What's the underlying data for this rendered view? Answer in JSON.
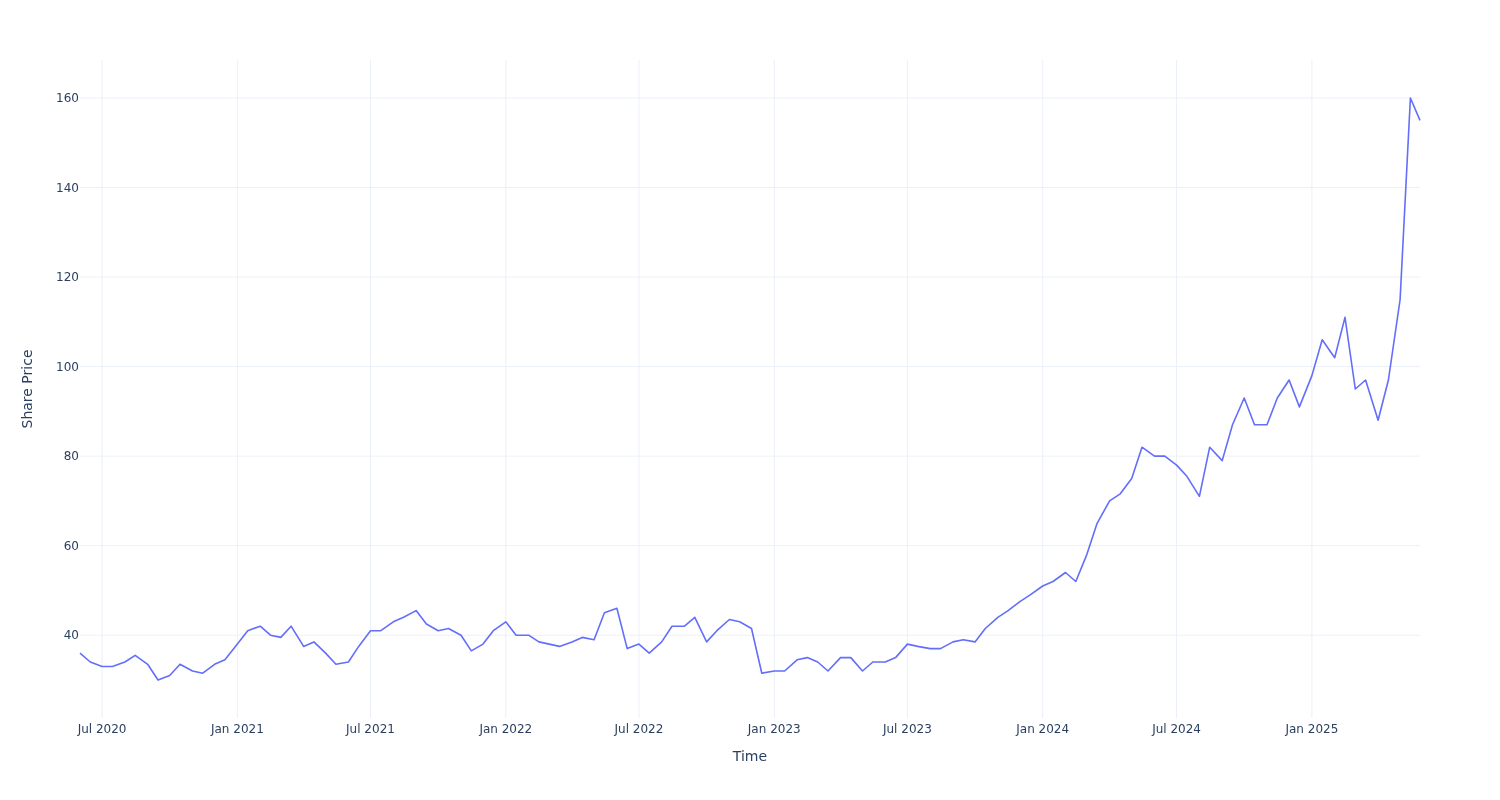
{
  "chart": {
    "chart_data": {
      "type": "line",
      "xlabel": "Time",
      "ylabel": "Share Price",
      "x": [
        "2020-06-01",
        "2020-06-15",
        "2020-07-01",
        "2020-07-15",
        "2020-08-01",
        "2020-08-15",
        "2020-09-01",
        "2020-09-15",
        "2020-10-01",
        "2020-10-15",
        "2020-11-01",
        "2020-11-15",
        "2020-12-01",
        "2020-12-15",
        "2021-01-01",
        "2021-01-15",
        "2021-02-01",
        "2021-02-15",
        "2021-03-01",
        "2021-03-15",
        "2021-04-01",
        "2021-04-15",
        "2021-05-01",
        "2021-05-15",
        "2021-06-01",
        "2021-06-15",
        "2021-07-01",
        "2021-07-15",
        "2021-08-01",
        "2021-08-15",
        "2021-09-01",
        "2021-09-15",
        "2021-10-01",
        "2021-10-15",
        "2021-11-01",
        "2021-11-15",
        "2021-12-01",
        "2021-12-15",
        "2022-01-01",
        "2022-01-15",
        "2022-02-01",
        "2022-02-15",
        "2022-03-01",
        "2022-03-15",
        "2022-04-01",
        "2022-04-15",
        "2022-05-01",
        "2022-05-15",
        "2022-06-01",
        "2022-06-15",
        "2022-07-01",
        "2022-07-15",
        "2022-08-01",
        "2022-08-15",
        "2022-09-01",
        "2022-09-15",
        "2022-10-01",
        "2022-10-15",
        "2022-11-01",
        "2022-11-15",
        "2022-12-01",
        "2022-12-15",
        "2023-01-01",
        "2023-01-15",
        "2023-02-01",
        "2023-02-15",
        "2023-03-01",
        "2023-03-15",
        "2023-04-01",
        "2023-04-15",
        "2023-05-01",
        "2023-05-15",
        "2023-06-01",
        "2023-06-15",
        "2023-07-01",
        "2023-07-15",
        "2023-08-01",
        "2023-08-15",
        "2023-09-01",
        "2023-09-15",
        "2023-10-01",
        "2023-10-15",
        "2023-11-01",
        "2023-11-15",
        "2023-12-01",
        "2023-12-15",
        "2024-01-01",
        "2024-01-15",
        "2024-02-01",
        "2024-02-15",
        "2024-03-01",
        "2024-03-15",
        "2024-04-01",
        "2024-04-15",
        "2024-05-01",
        "2024-05-15",
        "2024-06-01",
        "2024-06-15",
        "2024-07-01",
        "2024-07-15",
        "2024-08-01",
        "2024-08-15",
        "2024-09-01",
        "2024-09-15",
        "2024-10-01",
        "2024-10-15",
        "2024-11-01",
        "2024-11-15",
        "2024-12-01",
        "2024-12-15",
        "2025-01-01",
        "2025-01-15",
        "2025-02-01",
        "2025-02-15",
        "2025-03-01",
        "2025-03-15",
        "2025-04-01",
        "2025-04-15",
        "2025-05-01",
        "2025-05-15",
        "2025-05-28"
      ],
      "values": [
        36,
        34,
        33,
        33,
        34,
        35.5,
        33.5,
        30,
        31,
        33.5,
        32,
        31.5,
        33.5,
        34.5,
        38,
        41,
        42,
        40,
        39.5,
        42,
        37.5,
        38.5,
        36,
        33.5,
        34,
        37.5,
        41,
        41,
        43,
        44,
        45.5,
        42.5,
        41,
        41.5,
        40,
        36.5,
        38,
        41,
        43,
        40,
        40,
        38.5,
        38,
        37.5,
        38.5,
        39.5,
        39,
        45,
        46,
        37,
        38,
        36,
        38.5,
        42,
        42,
        44,
        38.5,
        41,
        43.5,
        43,
        41.5,
        31.5,
        32,
        32,
        34.5,
        35,
        34,
        32,
        35,
        35,
        32,
        34,
        34,
        35,
        38,
        37.5,
        37,
        37,
        38.5,
        39,
        38.5,
        41.5,
        44,
        45.5,
        47.5,
        49,
        51,
        52,
        54,
        52,
        58,
        65,
        70,
        71.5,
        75,
        82,
        80,
        80,
        78,
        75.5,
        71,
        82,
        79,
        87,
        93,
        87,
        87,
        93,
        97,
        91,
        98,
        106,
        102,
        111,
        95,
        97,
        88,
        97,
        115,
        160,
        155
      ],
      "xlim": [
        "2020-06-01",
        "2025-05-28"
      ],
      "ylim": [
        21.5,
        168.5
      ],
      "xticks": [
        {
          "value": "2020-07-01",
          "label": "Jul 2020"
        },
        {
          "value": "2021-01-01",
          "label": "Jan 2021"
        },
        {
          "value": "2021-07-01",
          "label": "Jul 2021"
        },
        {
          "value": "2022-01-01",
          "label": "Jan 2022"
        },
        {
          "value": "2022-07-01",
          "label": "Jul 2022"
        },
        {
          "value": "2023-01-01",
          "label": "Jan 2023"
        },
        {
          "value": "2023-07-01",
          "label": "Jul 2023"
        },
        {
          "value": "2024-01-01",
          "label": "Jan 2024"
        },
        {
          "value": "2024-07-01",
          "label": "Jul 2024"
        },
        {
          "value": "2025-01-01",
          "label": "Jan 2025"
        }
      ],
      "yticks": [
        40,
        60,
        80,
        100,
        120,
        140,
        160
      ],
      "grid": true
    }
  }
}
